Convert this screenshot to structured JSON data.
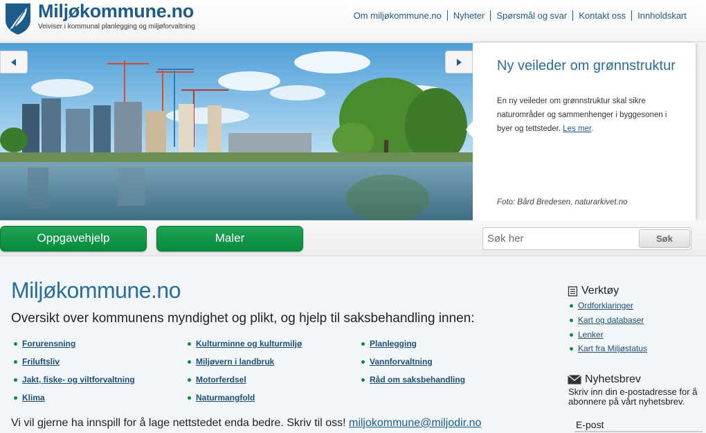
{
  "header": {
    "title": "Miljøkommune.no",
    "tagline": "Veiviser i kommunal planlegging og miljøforvaltning",
    "nav": [
      "Om miljøkommune.no",
      "Nyheter",
      "Spørsmål og svar",
      "Kontakt oss",
      "Innholdskart"
    ],
    "icons": {
      "logo": "leaf-shield-icon"
    }
  },
  "hero": {
    "title": "Ny veileder om grønnstruktur",
    "text": "En ny veileder om grønnstruktur skal sikre naturområder og sammenhenger i byggesonen i byer og tettsteder.",
    "link": "Les mer",
    "link_suffix": ".",
    "credit": "Foto: Bård Bredesen, naturarkivet.no",
    "icons": {
      "prev": "arrow-left-icon",
      "next": "arrow-right-icon"
    }
  },
  "buttons": {
    "oppgavehjelp": "Oppgavehjelp",
    "maler": "Maler"
  },
  "search": {
    "placeholder": "Søk her",
    "button": "Søk"
  },
  "main": {
    "title": "Miljøkommune.no",
    "subtitle": "Oversikt over kommunens myndighet og plikt, og hjelp til saksbehandling innen:",
    "categories": [
      "Forurensning",
      "Friluftsliv",
      "Jakt, fiske- og viltforvaltning",
      "Klima",
      "Kulturminne og kulturmiljø",
      "Miljøvern i landbruk",
      "Motorferdsel",
      "Naturmangfold",
      "Planlegging",
      "Vannforvaltning",
      "Råd om saksbehandling"
    ],
    "feedback_text": "Vi vil gjerne ha innspill for å lage nettstedet enda bedre. Skriv til oss!",
    "feedback_email": "miljokommune@miljodir.no"
  },
  "sidebar": {
    "tools_title": "Verktøy",
    "tools": [
      "Ordforklaringer",
      "Kart og databaser",
      "Lenker",
      "Kart fra Miljøstatus"
    ],
    "newsletter_title": "Nyhetsbrev",
    "newsletter_text": "Skriv inn din e-postadresse for å abonnere på vårt nyhetsbrev.",
    "email_label": "E-post",
    "icons": {
      "tools": "document-icon",
      "newsletter": "envelope-icon"
    }
  },
  "colors": {
    "brand_blue": "#1d5c8a",
    "button_green": "#0f9247",
    "main_bg": "#f2f6f9"
  }
}
